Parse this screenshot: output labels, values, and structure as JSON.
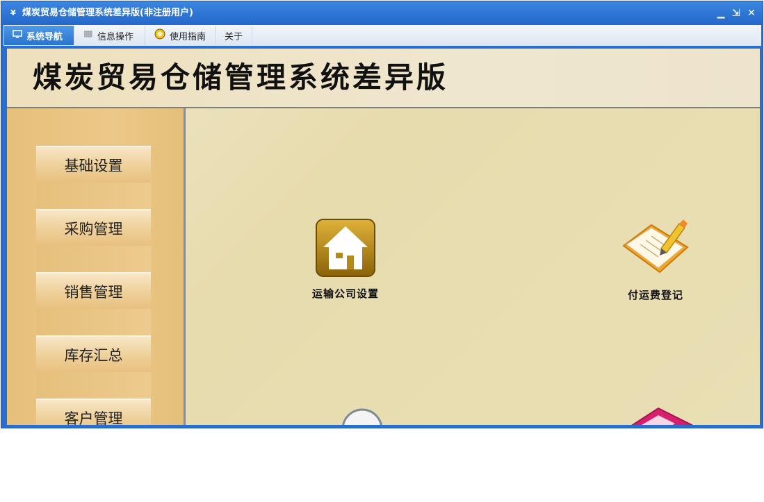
{
  "window": {
    "title": "煤炭贸易仓储管理系统差异版(非注册用户)",
    "controls": {
      "minimize": "▁",
      "restore": "⇲",
      "close": "✕"
    }
  },
  "menu": {
    "tabs": [
      {
        "label": "系统导航",
        "icon": "monitor-icon",
        "active": true
      },
      {
        "label": "信息操作",
        "icon": "grid-icon",
        "active": false
      },
      {
        "label": "使用指南",
        "icon": "help-circle-icon",
        "active": false
      },
      {
        "label": "关于",
        "icon": "",
        "active": false
      }
    ]
  },
  "banner": {
    "title": "煤炭贸易仓储管理系统差异版"
  },
  "sidebar": {
    "items": [
      {
        "label": "基础设置"
      },
      {
        "label": "采购管理"
      },
      {
        "label": "销售管理"
      },
      {
        "label": "库存汇总"
      },
      {
        "label": "客户管理"
      }
    ]
  },
  "tiles": [
    {
      "label": "运输公司设置",
      "icon": "house-icon"
    },
    {
      "label": "付运费登记",
      "icon": "notebook-pen-icon"
    }
  ],
  "colors": {
    "titlebar": "#2a6fce",
    "active_tab": "#2a74cf",
    "sidebar": "#e6c07a",
    "content_bg": "#e7dcae"
  }
}
